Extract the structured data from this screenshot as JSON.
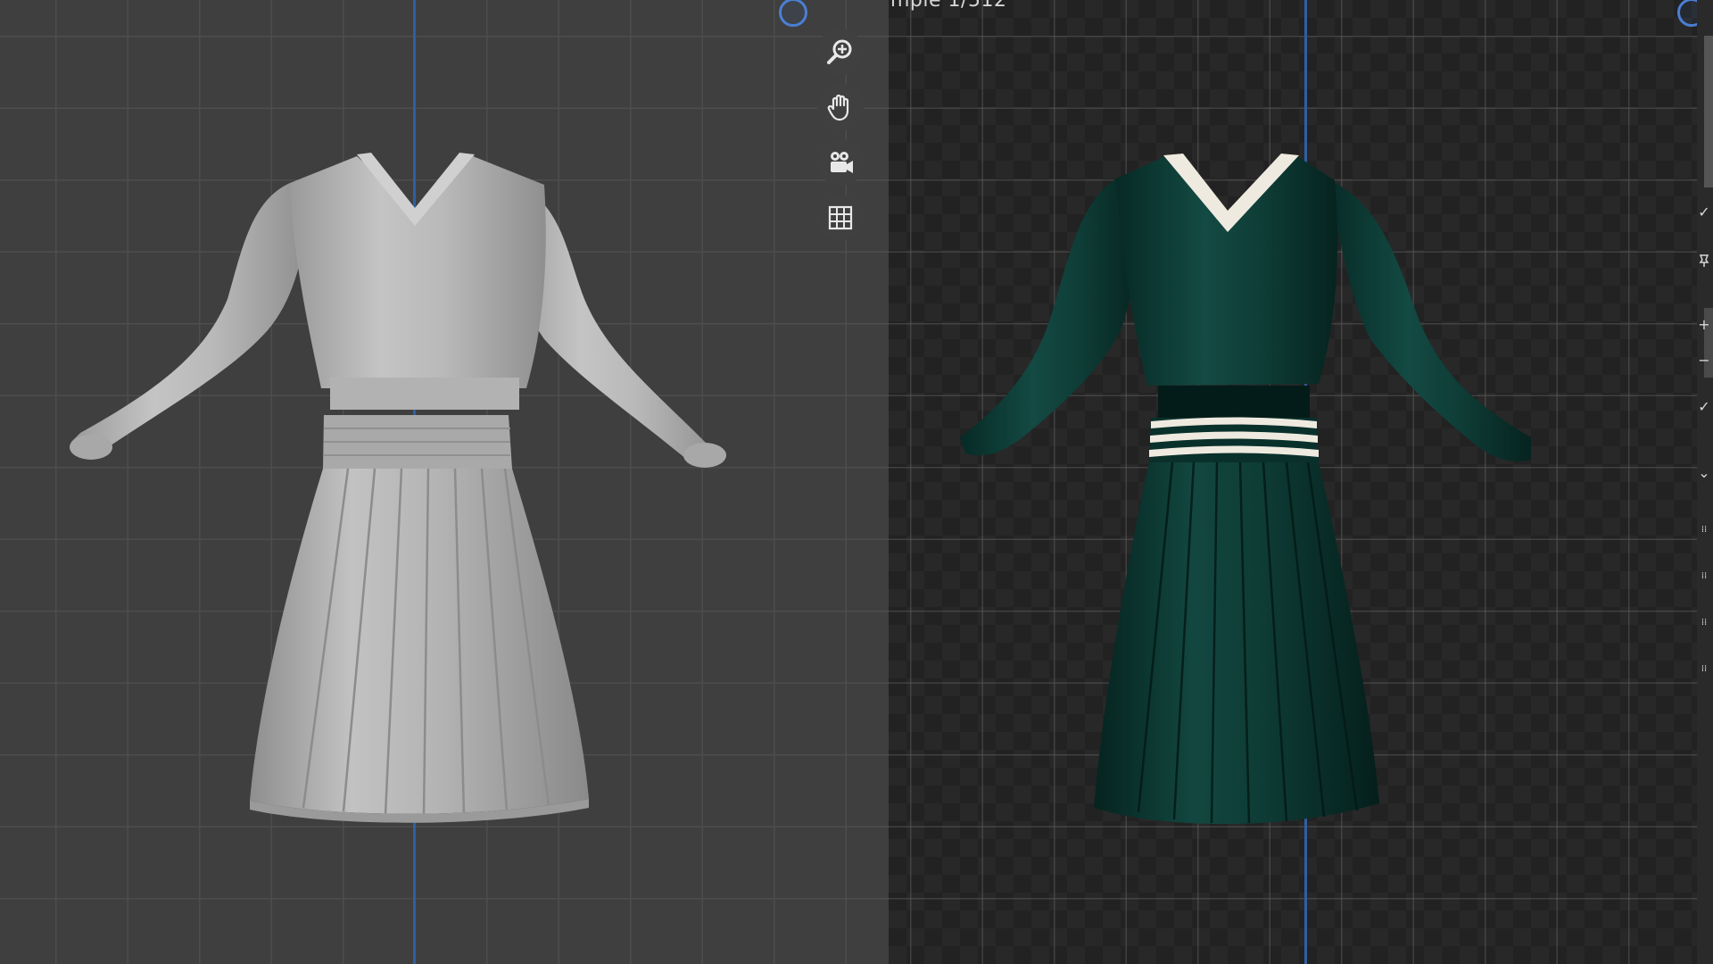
{
  "render_view": {
    "sample_counter": "mple 1/512"
  },
  "navigation_tools": [
    {
      "name": "zoom",
      "icon": "zoom-in-icon"
    },
    {
      "name": "pan",
      "icon": "hand-icon"
    },
    {
      "name": "camera",
      "icon": "camera-icon"
    },
    {
      "name": "ortho",
      "icon": "grid-icon"
    }
  ],
  "side_panel_icons": [
    "check-icon",
    "pin-icon",
    "plus-icon",
    "minus-icon",
    "check-icon",
    "chevron-down-icon",
    "drag-handle-icon",
    "drag-handle-icon",
    "drag-handle-icon",
    "drag-handle-icon"
  ],
  "colors": {
    "viewport_bg": "#3f3f3f",
    "axis_blue": "#2f5fa3",
    "clay_garment": "#b8b8b8",
    "green_fabric": "#0f3d37",
    "trim_white": "#eeeae0"
  },
  "side_glyphs": {
    "check": "✓",
    "plus": "+",
    "minus": "−",
    "chevron": "⌄",
    "grip": "⁞⁞"
  }
}
